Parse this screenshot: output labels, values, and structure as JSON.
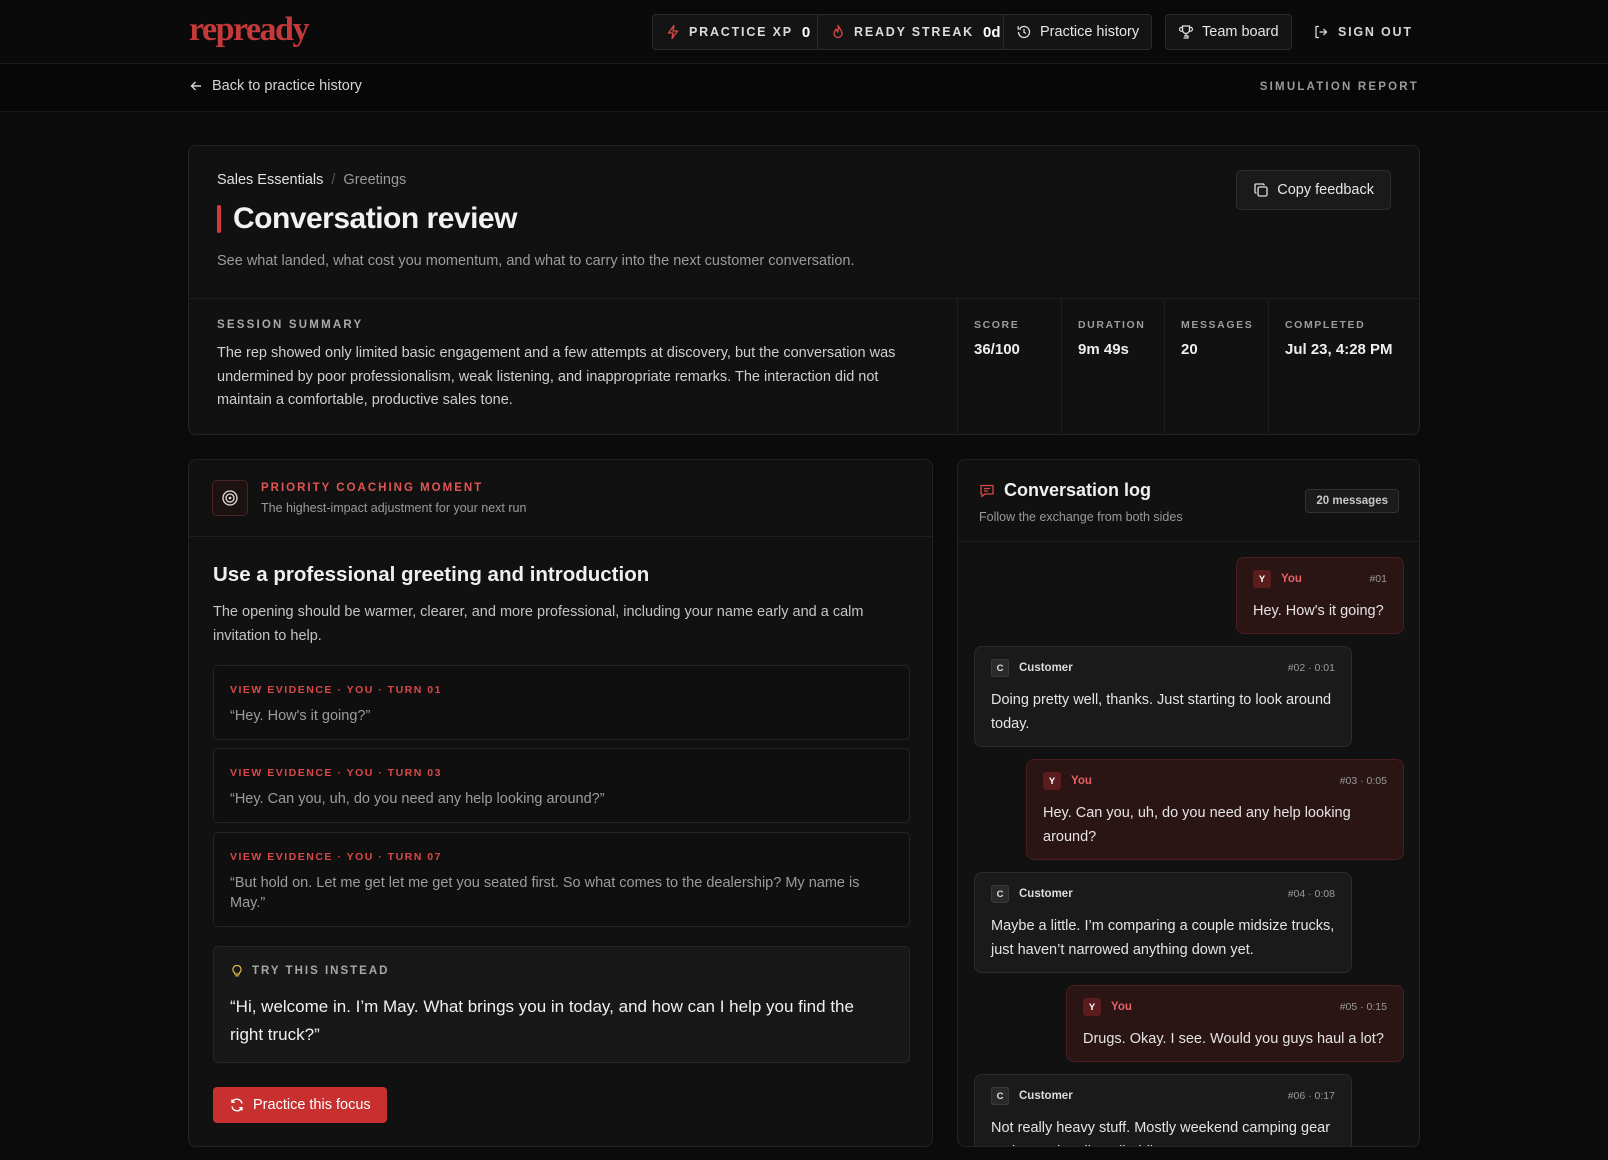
{
  "nav": {
    "logo": "repready",
    "practice_xp_label": "PRACTICE XP",
    "practice_xp_value": "0",
    "ready_streak_label": "READY STREAK",
    "ready_streak_value": "0d",
    "history_label": "Practice history",
    "team_board_label": "Team board",
    "sign_out_label": "SIGN OUT"
  },
  "subbar": {
    "back_label": "Back to practice history",
    "report_label": "SIMULATION REPORT"
  },
  "header": {
    "breadcrumb": [
      "Sales Essentials",
      "Greetings"
    ],
    "title": "Conversation review",
    "subtitle": "See what landed, what cost you momentum, and what to carry into the next customer conversation.",
    "copy_label": "Copy feedback",
    "summary_label": "SESSION SUMMARY",
    "summary_text": "The rep showed only limited basic engagement and a few attempts at discovery, but the conversation was undermined by poor professionalism, weak listening, and inappropriate remarks. The interaction did not maintain a comfortable, productive sales tone.",
    "stats": [
      {
        "label": "SCORE",
        "value": "36/100"
      },
      {
        "label": "DURATION",
        "value": "9m 49s"
      },
      {
        "label": "MESSAGES",
        "value": "20"
      },
      {
        "label": "COMPLETED",
        "value": "Jul 23, 4:28 PM"
      }
    ]
  },
  "coaching": {
    "kicker": "PRIORITY COACHING MOMENT",
    "kicker_sub": "The highest-impact adjustment for your next run",
    "heading": "Use a professional greeting and introduction",
    "description": "The opening should be warmer, clearer, and more professional, including your name early and a calm invitation to help.",
    "evidence": [
      {
        "tag": "VIEW EVIDENCE · YOU · TURN 01",
        "quote": "“Hey. How's it going?”"
      },
      {
        "tag": "VIEW EVIDENCE · YOU · TURN 03",
        "quote": "“Hey. Can you, uh, do you need any help looking around?”"
      },
      {
        "tag": "VIEW EVIDENCE · YOU · TURN 07",
        "quote": "“But hold on. Let me get let me get you seated first. So what comes to the dealership? My name is May.”"
      }
    ],
    "try_label": "TRY THIS INSTEAD",
    "try_quote": "“Hi, welcome in. I’m May. What brings you in today, and how can I help you find the right truck?”",
    "practice_label": "Practice this focus"
  },
  "log": {
    "title": "Conversation log",
    "subtitle": "Follow the exchange from both sides",
    "count_label": "20 messages",
    "messages": [
      {
        "role": "you",
        "initial": "Y",
        "who": "You",
        "meta": "#01",
        "text": "Hey. How's it going?"
      },
      {
        "role": "cust",
        "initial": "C",
        "who": "Customer",
        "meta": "#02 · 0:01",
        "text": "Doing pretty well, thanks. Just starting to look around today."
      },
      {
        "role": "you",
        "initial": "Y",
        "who": "You",
        "meta": "#03 · 0:05",
        "text": "Hey. Can you, uh, do you need any help looking around?"
      },
      {
        "role": "cust",
        "initial": "C",
        "who": "Customer",
        "meta": "#04 · 0:08",
        "text": "Maybe a little. I’m comparing a couple midsize trucks, just haven’t narrowed anything down yet."
      },
      {
        "role": "you",
        "initial": "Y",
        "who": "You",
        "meta": "#05 · 0:15",
        "text": "Drugs. Okay. I see. Would you guys haul a lot?"
      },
      {
        "role": "cust",
        "initial": "C",
        "who": "Customer",
        "meta": "#06 · 0:17",
        "text": "Not really heavy stuff. Mostly weekend camping gear and occasionally a dirt bike."
      }
    ]
  }
}
